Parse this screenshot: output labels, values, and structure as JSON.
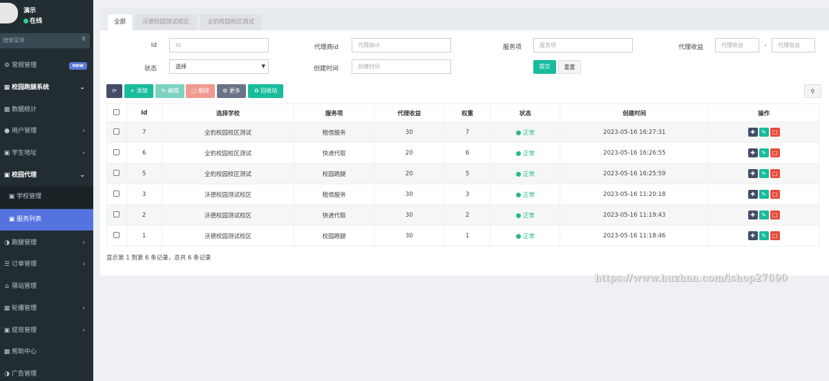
{
  "user": {
    "name": "演示",
    "status": "在线"
  },
  "search": {
    "placeholder": "搜索菜单"
  },
  "menu": [
    {
      "label": "常规管理",
      "icon": "cogs-icon",
      "badge": "new"
    },
    {
      "label": "校园跑腿系统",
      "icon": "list-icon"
    },
    {
      "label": "数据统计",
      "icon": "bar-chart-icon"
    },
    {
      "label": "用户管理",
      "icon": "user-circle-icon"
    },
    {
      "label": "学生地址",
      "icon": "address-card-icon"
    },
    {
      "label": "校园代理",
      "icon": "square-icon"
    },
    {
      "label": "学校管理",
      "icon": "square-icon"
    },
    {
      "label": "服务列表",
      "icon": "square-icon"
    },
    {
      "label": "跑腿管理",
      "icon": "circle-half-icon"
    },
    {
      "label": "订单管理",
      "icon": "bars-icon"
    },
    {
      "label": "驿站管理",
      "icon": "home-icon"
    },
    {
      "label": "轮播管理",
      "icon": "image-icon"
    },
    {
      "label": "提现管理",
      "icon": "money-icon"
    },
    {
      "label": "帮助中心",
      "icon": "bar-chart-icon"
    },
    {
      "label": "广告管理",
      "icon": "circle-half-icon"
    }
  ],
  "tabs": [
    "全部",
    "沃德校园测试校区",
    "全豹校园校区测试"
  ],
  "filters": {
    "id": {
      "label": "Id",
      "placeholder": "Id"
    },
    "agent_id": {
      "label": "代理商id",
      "placeholder": "代理商id"
    },
    "service": {
      "label": "服务项",
      "placeholder": "服务项"
    },
    "income": {
      "label": "代理收益",
      "placeholder_min": "代理收益",
      "separator": "-",
      "placeholder_max": "代理收益"
    },
    "status": {
      "label": "状态",
      "value": "选择"
    },
    "created": {
      "label": "创建时间",
      "placeholder": "创建时间"
    },
    "submit": "提交",
    "reset": "重置"
  },
  "toolbar": {
    "add": "添加",
    "edit": "编辑",
    "delete": "删除",
    "more": "更多",
    "recycle": "回收站"
  },
  "table": {
    "headers": [
      "Id",
      "选择学校",
      "服务项",
      "代理收益",
      "权重",
      "状态",
      "创建时间",
      "操作"
    ],
    "rows": [
      {
        "id": "7",
        "school": "全豹校园校区测试",
        "service": "租借服务",
        "income": "30",
        "weight": "7",
        "status": "正常",
        "created": "2023-05-16 16:27:31"
      },
      {
        "id": "6",
        "school": "全豹校园校区测试",
        "service": "快递代取",
        "income": "20",
        "weight": "6",
        "status": "正常",
        "created": "2023-05-16 16:26:55"
      },
      {
        "id": "5",
        "school": "全豹校园校区测试",
        "service": "校园跑腿",
        "income": "20",
        "weight": "5",
        "status": "正常",
        "created": "2023-05-16 16:25:59"
      },
      {
        "id": "3",
        "school": "沃德校园测试校区",
        "service": "租借服务",
        "income": "30",
        "weight": "3",
        "status": "正常",
        "created": "2023-05-16 11:20:18"
      },
      {
        "id": "2",
        "school": "沃德校园测试校区",
        "service": "快递代取",
        "income": "30",
        "weight": "2",
        "status": "正常",
        "created": "2023-05-16 11:19:43"
      },
      {
        "id": "1",
        "school": "沃德校园测试校区",
        "service": "校园跑腿",
        "income": "30",
        "weight": "1",
        "status": "正常",
        "created": "2023-05-16 11:18:46"
      }
    ]
  },
  "footer": "显示第 1 到第 6 条记录，总共 6 条记录",
  "watermark": "https://www.huzhan.com/ishop27690",
  "colors": {
    "sidebar": "#222d32",
    "active": "#5573de",
    "primary": "#18bc9c",
    "danger": "#e74c3c",
    "dark": "#444c69"
  }
}
